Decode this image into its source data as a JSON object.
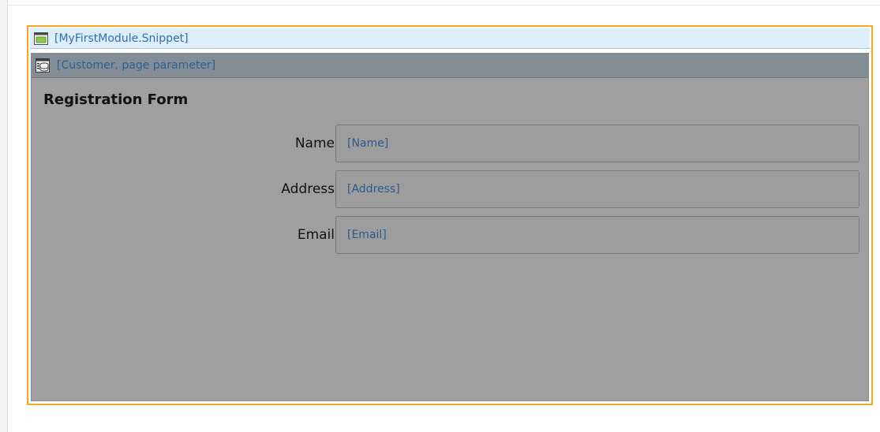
{
  "snippet": {
    "title": "[MyFirstModule.Snippet]",
    "icon": "snippet-icon",
    "frame_color": "#f5a623"
  },
  "dataview": {
    "title": "[Customer, page parameter]",
    "icon": "dataview-icon"
  },
  "form": {
    "heading": "Registration Form",
    "fields": [
      {
        "label": "Name",
        "value": "[Name]"
      },
      {
        "label": "Address",
        "value": "[Address]"
      },
      {
        "label": "Email",
        "value": "[Email]"
      }
    ]
  }
}
